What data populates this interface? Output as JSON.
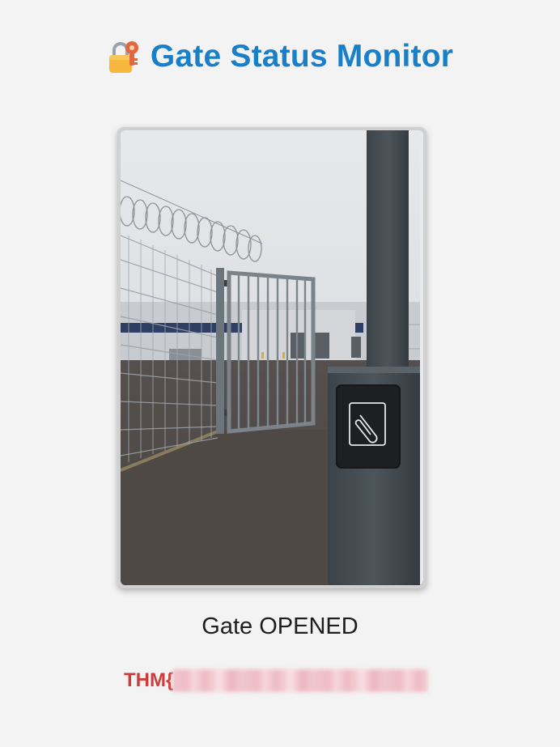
{
  "header": {
    "icon": "locked-with-key-icon",
    "title": "Gate Status Monitor",
    "title_color": "#1a7fc9"
  },
  "photo": {
    "subject": "gate-scene-image"
  },
  "status": {
    "text": "Gate OPENED"
  },
  "flag": {
    "prefix": "THM{",
    "prefix_color": "#d03a3a",
    "redacted": true
  }
}
